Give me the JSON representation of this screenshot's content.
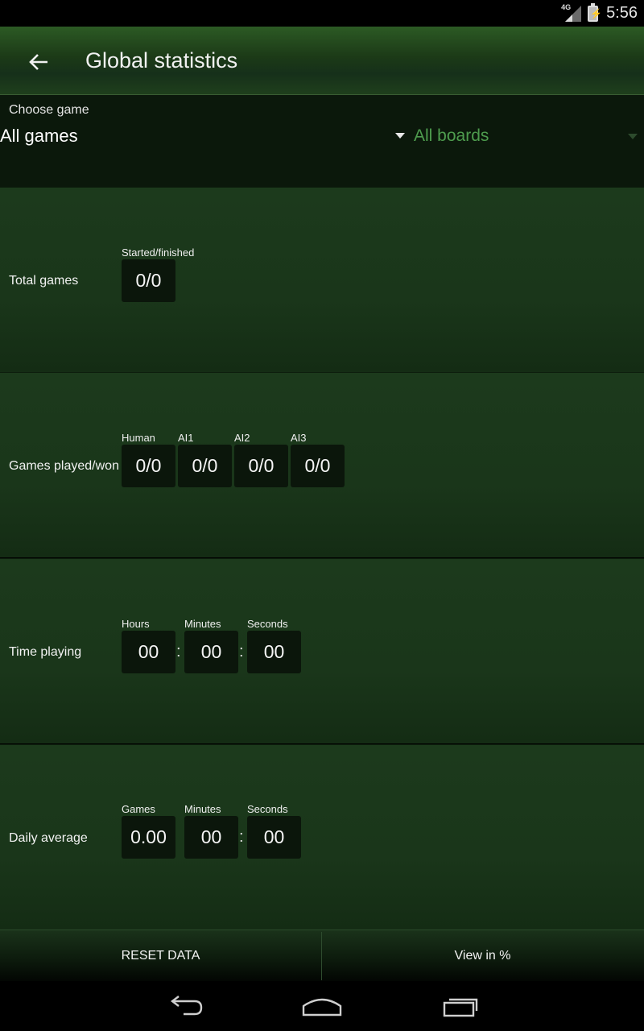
{
  "status_bar": {
    "network": "4G",
    "time": "5:56"
  },
  "header": {
    "title": "Global statistics",
    "back_icon": "arrow-back-icon"
  },
  "filter": {
    "choose_label": "Choose game",
    "game_value": "All games",
    "board_value": "All boards"
  },
  "stats": {
    "total_games": {
      "label": "Total games",
      "caption": "Started/finished",
      "value": "0/0"
    },
    "games_played": {
      "label": "Games played/won",
      "players": [
        {
          "caption": "Human",
          "value": "0/0"
        },
        {
          "caption": "AI1",
          "value": "0/0"
        },
        {
          "caption": "AI2",
          "value": "0/0"
        },
        {
          "caption": "AI3",
          "value": "0/0"
        }
      ]
    },
    "time_playing": {
      "label": "Time playing",
      "hours_caption": "Hours",
      "hours": "00",
      "minutes_caption": "Minutes",
      "minutes": "00",
      "seconds_caption": "Seconds",
      "seconds": "00",
      "separator": ":"
    },
    "daily_average": {
      "label": "Daily average",
      "games_caption": "Games",
      "games": "0.00",
      "minutes_caption": "Minutes",
      "minutes": "00",
      "seconds_caption": "Seconds",
      "seconds": "00",
      "separator": ":"
    }
  },
  "buttons": {
    "reset": "RESET DATA",
    "view_percent": "View in %"
  },
  "colors": {
    "accent_green": "#4e9c4e",
    "header_green": "#2c5a24",
    "section_green": "#1c3a1c"
  }
}
